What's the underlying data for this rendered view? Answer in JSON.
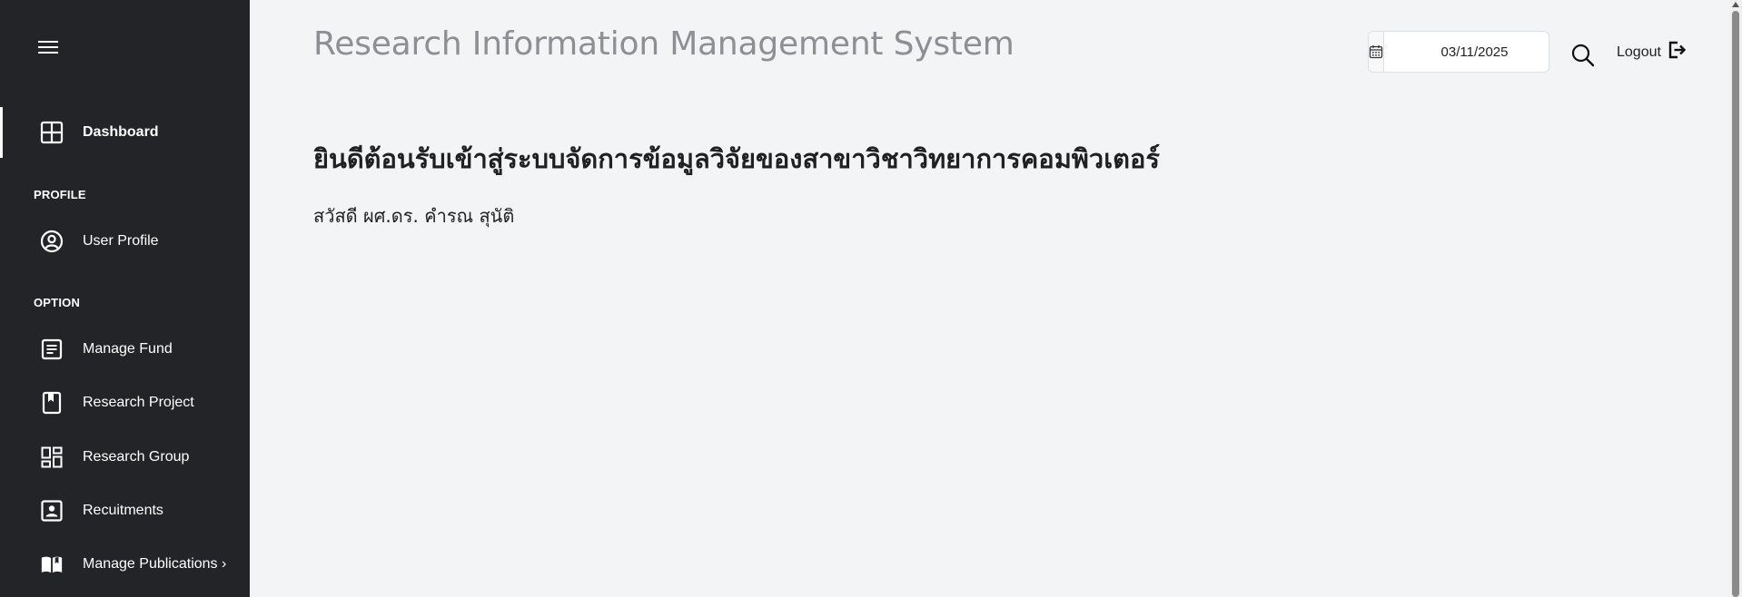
{
  "app_title": "Research Information Management System",
  "sidebar": {
    "dashboard": {
      "label": "Dashboard",
      "icon": "dashboard-grid-icon"
    },
    "section_profile": "PROFILE",
    "user_profile": {
      "label": "User Profile",
      "icon": "user-circle-icon"
    },
    "section_option": "OPTION",
    "items": [
      {
        "label": "Manage Fund",
        "icon": "document-list-icon"
      },
      {
        "label": "Research Project",
        "icon": "bookmark-icon"
      },
      {
        "label": "Research Group",
        "icon": "layout-blocks-icon"
      },
      {
        "label": "Recuitments",
        "icon": "id-card-icon"
      },
      {
        "label": "Manage Publications ›",
        "icon": "open-book-icon"
      }
    ]
  },
  "header": {
    "date_value": "03/11/2025",
    "logout_label": "Logout"
  },
  "main": {
    "welcome": "ยินดีต้อนรับเข้าสู่ระบบจัดการข้อมูลวิจัยของสาขาวิชาวิทยาการคอมพิวเตอร์",
    "greeting": "สวัสดี ผศ.ดร. คำรณ สุนัติ"
  },
  "colors": {
    "sidebar_bg": "#232427",
    "page_bg": "#f3f4f6",
    "title_gray": "#8c8f94"
  }
}
